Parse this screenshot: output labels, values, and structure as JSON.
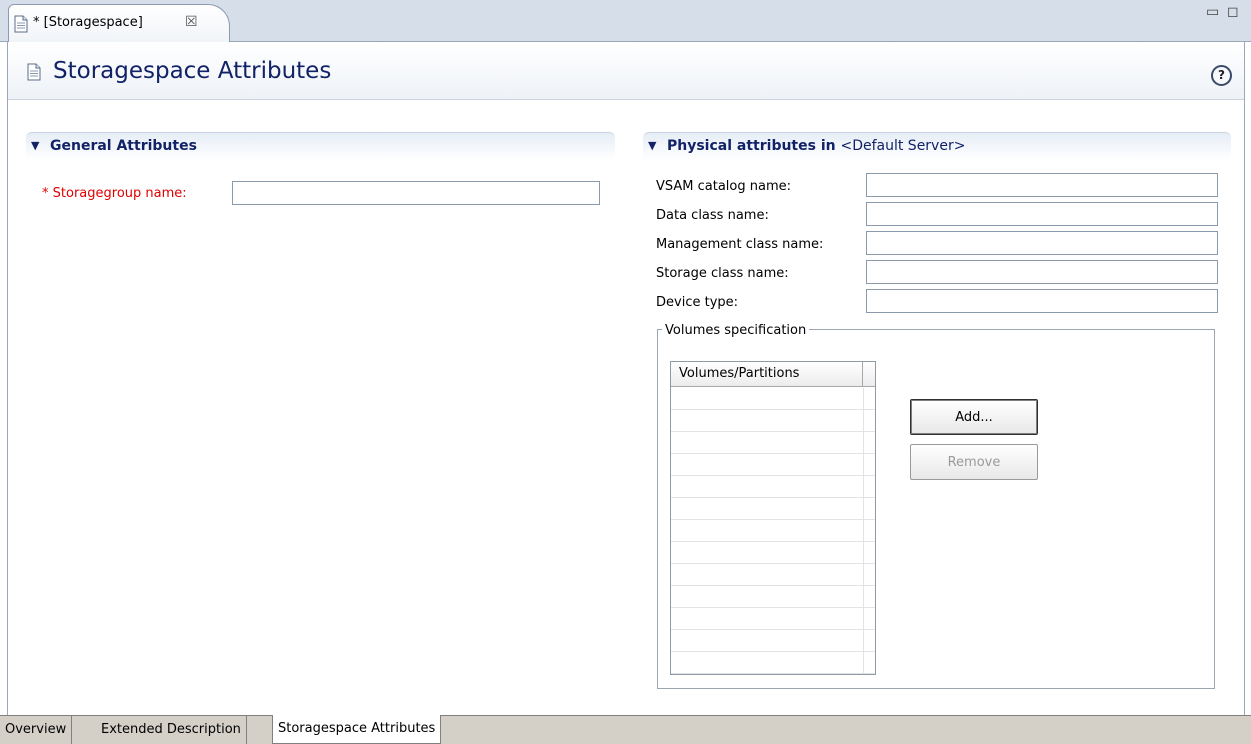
{
  "editor_tab": {
    "title": "* [Storagespace]",
    "icon": "document-icon",
    "close_icon": "close-icon"
  },
  "window_controls": {
    "minimize": "minimize-icon",
    "maximize": "maximize-icon"
  },
  "header": {
    "title": "Storagespace Attributes",
    "icon": "document-icon",
    "help_label": "?"
  },
  "general": {
    "section_title": "General Attributes",
    "storagegroup": {
      "required_marker": "*",
      "label": "Storagegroup name:",
      "value": ""
    }
  },
  "physical": {
    "section_title_bold": "Physical attributes in",
    "section_title_server": "<Default Server>",
    "fields": [
      {
        "label": "VSAM catalog name:",
        "value": ""
      },
      {
        "label": "Data class name:",
        "value": ""
      },
      {
        "label": "Management class name:",
        "value": ""
      },
      {
        "label": "Storage class name:",
        "value": ""
      },
      {
        "label": "Device type:",
        "value": ""
      }
    ],
    "volumes": {
      "group_title": "Volumes specification",
      "column": "Volumes/Partitions",
      "rows": [],
      "add_button": "Add...",
      "remove_button": "Remove",
      "remove_enabled": false
    }
  },
  "page_tabs": [
    "Overview",
    "Extended Description",
    "Storagespace Attributes"
  ],
  "active_page_tab": "Storagespace Attributes"
}
